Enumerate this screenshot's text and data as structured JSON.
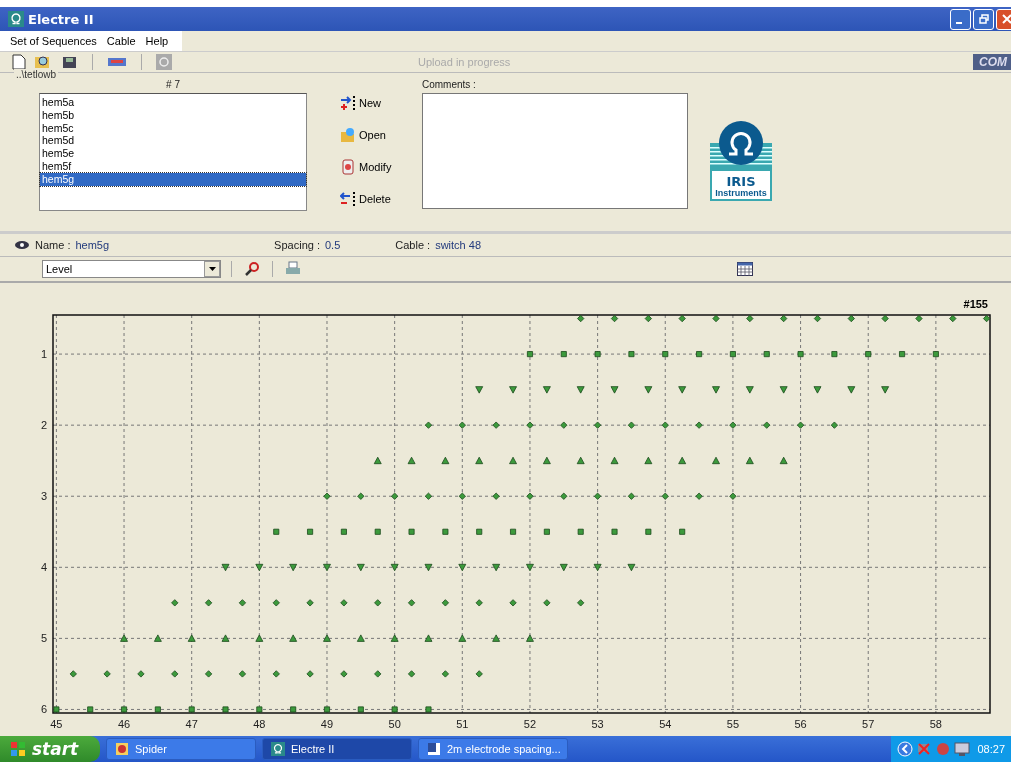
{
  "window": {
    "title": "Electre II"
  },
  "menu": [
    "Set of Sequences",
    "Cable",
    "Help"
  ],
  "toolbar": {
    "status": "Upload in progress",
    "port": "COM"
  },
  "sequences": {
    "folder": "..\\tetlowb",
    "count": "# 7",
    "items": [
      {
        "label": "hem5a",
        "selected": false
      },
      {
        "label": "hem5b",
        "selected": false
      },
      {
        "label": "hem5c",
        "selected": false
      },
      {
        "label": "hem5d",
        "selected": false
      },
      {
        "label": "hem5e",
        "selected": false
      },
      {
        "label": "hem5f",
        "selected": false
      },
      {
        "label": "hem5g",
        "selected": true
      }
    ],
    "actions": [
      {
        "kind": "new",
        "label": "New"
      },
      {
        "kind": "open",
        "label": "Open"
      },
      {
        "kind": "modify",
        "label": "Modify"
      },
      {
        "kind": "delete",
        "label": "Delete"
      }
    ],
    "comments_label": "Comments :"
  },
  "logo": {
    "name": "IRIS",
    "sub": "Instruments"
  },
  "info": {
    "name_label": "Name :",
    "name": "hem5g",
    "spacing_label": "Spacing :",
    "spacing": "0.5",
    "cable_label": "Cable :",
    "cable": "switch 48"
  },
  "view": {
    "mode": "Level"
  },
  "chart_data": {
    "type": "scatter",
    "title": "#155",
    "grid": true,
    "xlim": [
      44.95,
      58.8
    ],
    "ylim": [
      6.05,
      0.45
    ],
    "xticks": [
      45,
      46,
      47,
      48,
      49,
      50,
      51,
      52,
      53,
      54,
      55,
      56,
      57,
      58
    ],
    "yticks": [
      1,
      2,
      3,
      4,
      5,
      6
    ],
    "series": [
      {
        "color": "#3c9a3c",
        "x": [
          52.75,
          53.25,
          53.75,
          54.25,
          54.75,
          55.25,
          55.75,
          56.25,
          56.75,
          57.25,
          57.75,
          58.25,
          58.75
        ],
        "values": [
          0.5,
          0.5,
          0.5,
          0.5,
          0.5,
          0.5,
          0.5,
          0.5,
          0.5,
          0.5,
          0.5,
          0.5,
          0.5
        ]
      },
      {
        "color": "#3c9a3c",
        "x": [
          52,
          52.5,
          53,
          53.5,
          54,
          54.5,
          55,
          55.5,
          56,
          56.5,
          57,
          57.5,
          58
        ],
        "values": [
          1,
          1,
          1,
          1,
          1,
          1,
          1,
          1,
          1,
          1,
          1,
          1,
          1
        ]
      },
      {
        "color": "#3c9a3c",
        "x": [
          51.25,
          51.75,
          52.25,
          52.75,
          53.25,
          53.75,
          54.25,
          54.75,
          55.25,
          55.75,
          56.25,
          56.75,
          57.25
        ],
        "values": [
          1.5,
          1.5,
          1.5,
          1.5,
          1.5,
          1.5,
          1.5,
          1.5,
          1.5,
          1.5,
          1.5,
          1.5,
          1.5
        ]
      },
      {
        "color": "#3c9a3c",
        "x": [
          50.5,
          51,
          51.5,
          52,
          52.5,
          53,
          53.5,
          54,
          54.5,
          55,
          55.5,
          56,
          56.5
        ],
        "values": [
          2,
          2,
          2,
          2,
          2,
          2,
          2,
          2,
          2,
          2,
          2,
          2,
          2
        ]
      },
      {
        "color": "#3c9a3c",
        "x": [
          49.75,
          50.25,
          50.75,
          51.25,
          51.75,
          52.25,
          52.75,
          53.25,
          53.75,
          54.25,
          54.75,
          55.25,
          55.75
        ],
        "values": [
          2.5,
          2.5,
          2.5,
          2.5,
          2.5,
          2.5,
          2.5,
          2.5,
          2.5,
          2.5,
          2.5,
          2.5,
          2.5
        ]
      },
      {
        "color": "#3c9a3c",
        "x": [
          49,
          49.5,
          50,
          50.5,
          51,
          51.5,
          52,
          52.5,
          53,
          53.5,
          54,
          54.5,
          55
        ],
        "values": [
          3,
          3,
          3,
          3,
          3,
          3,
          3,
          3,
          3,
          3,
          3,
          3,
          3
        ]
      },
      {
        "color": "#3c9a3c",
        "x": [
          48.25,
          48.75,
          49.25,
          49.75,
          50.25,
          50.75,
          51.25,
          51.75,
          52.25,
          52.75,
          53.25,
          53.75,
          54.25
        ],
        "values": [
          3.5,
          3.5,
          3.5,
          3.5,
          3.5,
          3.5,
          3.5,
          3.5,
          3.5,
          3.5,
          3.5,
          3.5,
          3.5
        ]
      },
      {
        "color": "#3c9a3c",
        "x": [
          47.5,
          48,
          48.5,
          49,
          49.5,
          50,
          50.5,
          51,
          51.5,
          52,
          52.5,
          53,
          53.5
        ],
        "values": [
          4,
          4,
          4,
          4,
          4,
          4,
          4,
          4,
          4,
          4,
          4,
          4,
          4
        ]
      },
      {
        "color": "#3c9a3c",
        "x": [
          46.75,
          47.25,
          47.75,
          48.25,
          48.75,
          49.25,
          49.75,
          50.25,
          50.75,
          51.25,
          51.75,
          52.25,
          52.75
        ],
        "values": [
          4.5,
          4.5,
          4.5,
          4.5,
          4.5,
          4.5,
          4.5,
          4.5,
          4.5,
          4.5,
          4.5,
          4.5,
          4.5
        ]
      },
      {
        "color": "#3c9a3c",
        "x": [
          46,
          46.5,
          47,
          47.5,
          48,
          48.5,
          49,
          49.5,
          50,
          50.5,
          51,
          51.5,
          52
        ],
        "values": [
          5,
          5,
          5,
          5,
          5,
          5,
          5,
          5,
          5,
          5,
          5,
          5,
          5
        ]
      },
      {
        "color": "#3c9a3c",
        "x": [
          45.25,
          45.75,
          46.25,
          46.75,
          47.25,
          47.75,
          48.25,
          48.75,
          49.25,
          49.75,
          50.25,
          50.75,
          51.25
        ],
        "values": [
          5.5,
          5.5,
          5.5,
          5.5,
          5.5,
          5.5,
          5.5,
          5.5,
          5.5,
          5.5,
          5.5,
          5.5,
          5.5
        ]
      },
      {
        "color": "#3c9a3c",
        "x": [
          45,
          45.5,
          46,
          46.5,
          47,
          47.5,
          48,
          48.5,
          49,
          49.5,
          50,
          50.5
        ],
        "values": [
          6,
          6,
          6,
          6,
          6,
          6,
          6,
          6,
          6,
          6,
          6,
          6
        ]
      }
    ]
  },
  "taskbar": {
    "start": "start",
    "tasks": [
      {
        "label": "Spider",
        "kind": "game",
        "selected": false
      },
      {
        "label": "Electre II",
        "kind": "app",
        "selected": true
      },
      {
        "label": "2m electrode spacing...",
        "kind": "document",
        "selected": false
      }
    ],
    "clock": "08:27"
  }
}
